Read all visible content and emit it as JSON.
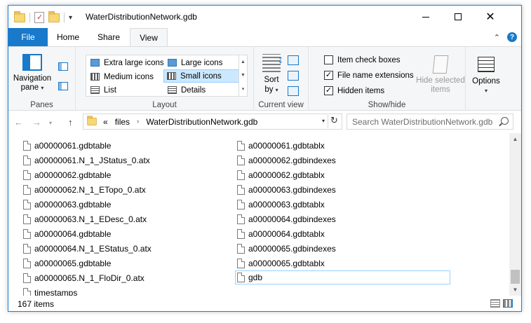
{
  "window": {
    "title": "WaterDistributionNetwork.gdb"
  },
  "ribbon_tabs": {
    "file": "File",
    "home": "Home",
    "share": "Share",
    "view": "View"
  },
  "panes": {
    "navigation_pane_line1": "Navigation",
    "navigation_pane_line2": "pane",
    "group_label": "Panes"
  },
  "layout": {
    "items": {
      "extra_large_icons": "Extra large icons",
      "large_icons": "Large icons",
      "medium_icons": "Medium icons",
      "small_icons": "Small icons",
      "list": "List",
      "details": "Details"
    },
    "selected": "Small icons",
    "group_label": "Layout"
  },
  "current_view": {
    "sort_by_line1": "Sort",
    "sort_by_line2": "by",
    "group_label": "Current view"
  },
  "show_hide": {
    "item_check_boxes": {
      "label": "Item check boxes",
      "checked": false
    },
    "file_name_extensions": {
      "label": "File name extensions",
      "checked": true
    },
    "hidden_items": {
      "label": "Hidden items",
      "checked": true
    },
    "hide_selected_line1": "Hide selected",
    "hide_selected_line2": "items",
    "group_label": "Show/hide"
  },
  "options": {
    "label": "Options"
  },
  "address_bar": {
    "overflow": "«",
    "crumbs": [
      "files",
      "WaterDistributionNetwork.gdb"
    ],
    "search_placeholder": "Search WaterDistributionNetwork.gdb"
  },
  "files": {
    "column1": [
      "a00000061.gdbtable",
      "a00000061.N_1_JStatus_0.atx",
      "a00000062.gdbtable",
      "a00000062.N_1_ETopo_0.atx",
      "a00000063.gdbtable",
      "a00000063.N_1_EDesc_0.atx",
      "a00000064.gdbtable",
      "a00000064.N_1_EStatus_0.atx",
      "a00000065.gdbtable",
      "a00000065.N_1_FloDir_0.atx",
      "timestamps"
    ],
    "column2": [
      "a00000061.gdbtablx",
      "a00000062.gdbindexes",
      "a00000062.gdbtablx",
      "a00000063.gdbindexes",
      "a00000063.gdbtablx",
      "a00000064.gdbindexes",
      "a00000064.gdbtablx",
      "a00000065.gdbindexes",
      "a00000065.gdbtablx",
      "gdb"
    ],
    "focused_item": "gdb"
  },
  "status": {
    "item_count": "167 items"
  },
  "colors": {
    "accent": "#1979ca",
    "ribbon_bg": "#f5f6f7",
    "selection": "#cce8ff"
  }
}
